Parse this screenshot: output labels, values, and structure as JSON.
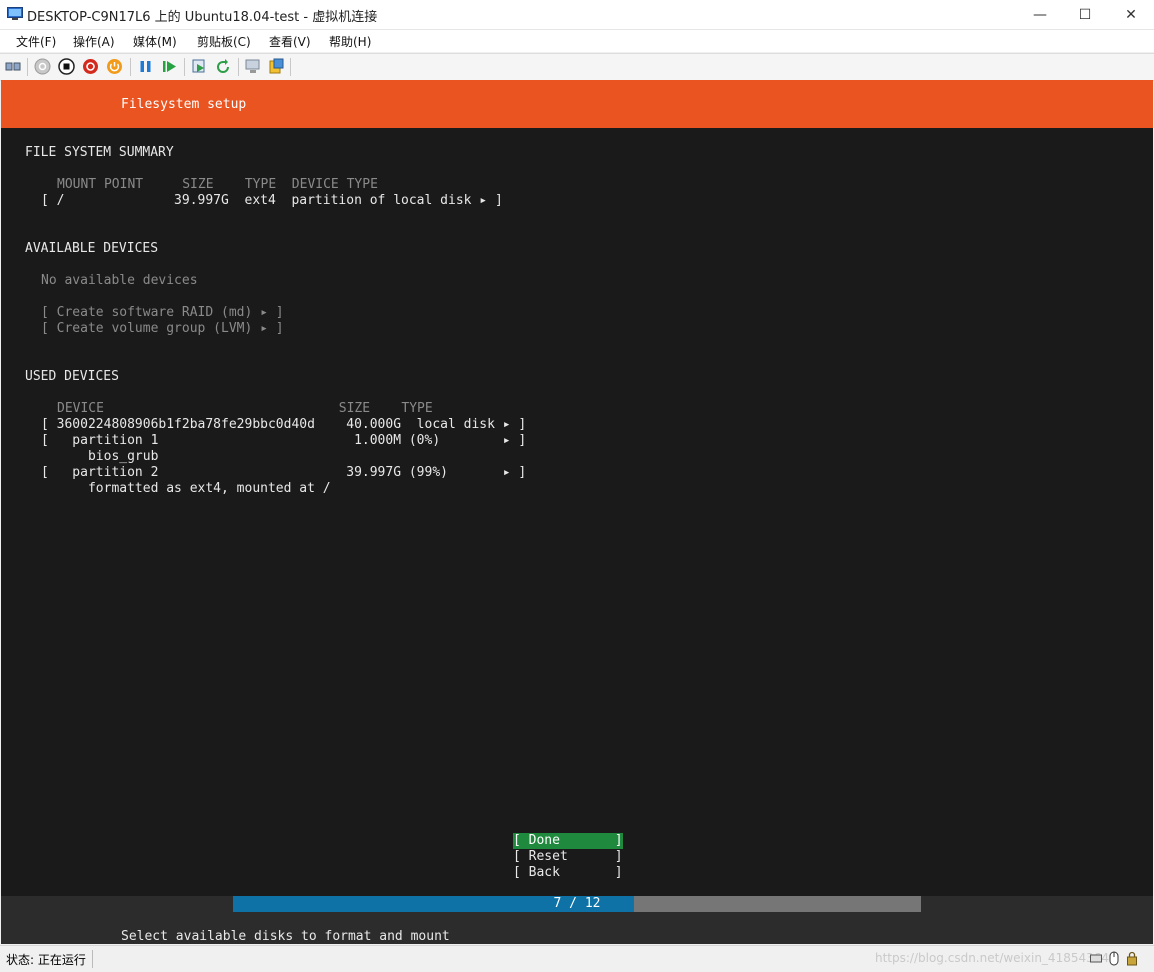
{
  "window": {
    "title": "DESKTOP-C9N17L6 上的 Ubuntu18.04-test - 虚拟机连接",
    "minimize_glyph": "—",
    "maximize_glyph": "☐",
    "close_glyph": "✕"
  },
  "menu": [
    "文件(F)",
    "操作(A)",
    "媒体(M)",
    "剪贴板(C)",
    "查看(V)",
    "帮助(H)"
  ],
  "toolbar_icons": [
    "ctrl-alt-del-icon",
    "start-icon",
    "turn-off-icon",
    "shutdown-icon",
    "power-icon",
    "pause-icon",
    "resume-icon",
    "checkpoint-icon",
    "revert-icon",
    "enhanced-session-icon",
    "share-icon"
  ],
  "installer": {
    "header": "Filesystem setup",
    "summary": {
      "heading": "FILE SYSTEM SUMMARY",
      "columns": "MOUNT POINT     SIZE    TYPE  DEVICE TYPE",
      "row": "[ /              39.997G  ext4  partition of local disk ▸ ]"
    },
    "available": {
      "heading": "AVAILABLE DEVICES",
      "empty": "No available devices",
      "raid": "[ Create software RAID (md) ▸ ]",
      "lvm": "[ Create volume group (LVM) ▸ ]"
    },
    "used": {
      "heading": "USED DEVICES",
      "columns": "DEVICE                              SIZE    TYPE",
      "rows": [
        "[ 3600224808906b1f2ba78fe29bbc0d40d    40.000G  local disk ▸ ]",
        "[   partition 1                         1.000M (0%)        ▸ ]",
        "      bios_grub",
        "[   partition 2                        39.997G (99%)       ▸ ]",
        "      formatted as ext4, mounted at /"
      ]
    },
    "buttons": {
      "done": "[ Done       ]",
      "reset": "[ Reset      ]",
      "back": "[ Back       ]"
    },
    "progress": {
      "label": "7 / 12",
      "current": 7,
      "total": 12
    },
    "hint": "Select available disks to format and mount"
  },
  "status": {
    "text": "状态: 正在运行",
    "watermark": "https://blog.csdn.net/weixin_41854364"
  },
  "colors": {
    "ubuntu_orange": "#e95420",
    "console_bg": "#1a1a1a",
    "selected_button": "#1f8a3e",
    "progress_fill": "#0e72a7",
    "progress_track": "#767676"
  }
}
